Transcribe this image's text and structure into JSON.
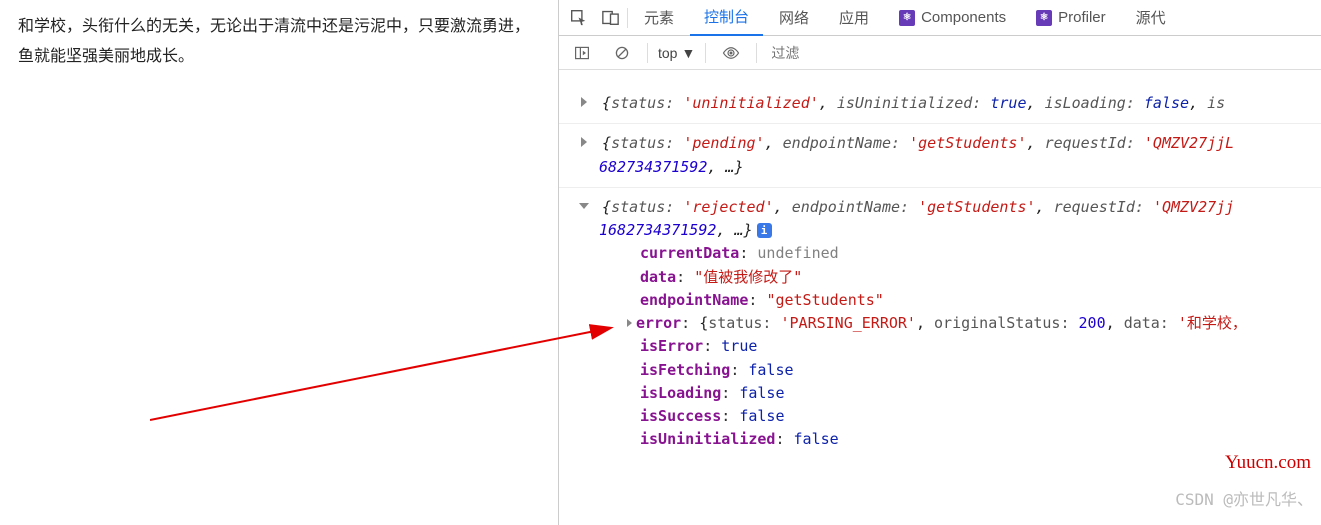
{
  "page": {
    "text": "和学校，头衔什么的无关，无论出于清流中还是污泥中，只要激流勇进，鱼就能坚强美丽地成长。"
  },
  "tabs": {
    "elements": "元素",
    "console": "控制台",
    "network": "网络",
    "application": "应用",
    "components": "Components",
    "profiler": "Profiler",
    "sources": "源代"
  },
  "toolbar": {
    "context": "top",
    "filter_placeholder": "过滤"
  },
  "logs": {
    "log1": "{status: 'uninitialized', isUninitialized: true, isLoading: false, is",
    "log2_line1": "{status: 'pending', endpointName: 'getStudents', requestId: 'QMZV27jjL",
    "log2_line2": "682734371592, …}",
    "log3_line1": "{status: 'rejected', endpointName: 'getStudents', requestId: 'QMZV27jj",
    "log3_line2": "1682734371592, …}",
    "log3": {
      "currentData": "undefined",
      "data": "\"值被我修改了\"",
      "endpointName": "\"getStudents\"",
      "error_preview": "{status: 'PARSING_ERROR', originalStatus: 200, data: '和学校，",
      "isError": "true",
      "isFetching": "false",
      "isLoading": "false",
      "isSuccess": "false",
      "isUninitialized": "false"
    }
  },
  "labels": {
    "currentData": "currentData",
    "data": "data",
    "endpointName": "endpointName",
    "error": "error",
    "isError": "isError",
    "isFetching": "isFetching",
    "isLoading": "isLoading",
    "isSuccess": "isSuccess",
    "isUninitialized": "isUninitialized"
  },
  "watermarks": {
    "site": "Yuucn.com",
    "author": "CSDN @亦世凡华、"
  }
}
